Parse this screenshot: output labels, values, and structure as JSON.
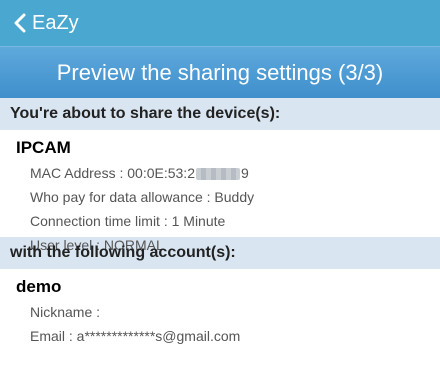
{
  "nav": {
    "back_label": "EaZy"
  },
  "title": "Preview the sharing settings (3/3)",
  "device_section": {
    "header": "You're about to share the device(s):",
    "device_name": "IPCAM",
    "mac_prefix": "MAC Address : 00:0E:53:2",
    "mac_suffix": "9",
    "who_pay": "Who pay for data allowance : Buddy",
    "time_limit": "Connection time limit : 1 Minute",
    "user_level": "User level : NORMAL"
  },
  "account_section": {
    "header": "with the following account(s):",
    "account_name": "demo",
    "nickname": "Nickname :",
    "email": "Email : a*************s@gmail.com"
  },
  "colors": {
    "topbar": "#4aa7cf",
    "titlebar": "#4a9ad4",
    "section_header_bg": "#d9e6f2"
  }
}
